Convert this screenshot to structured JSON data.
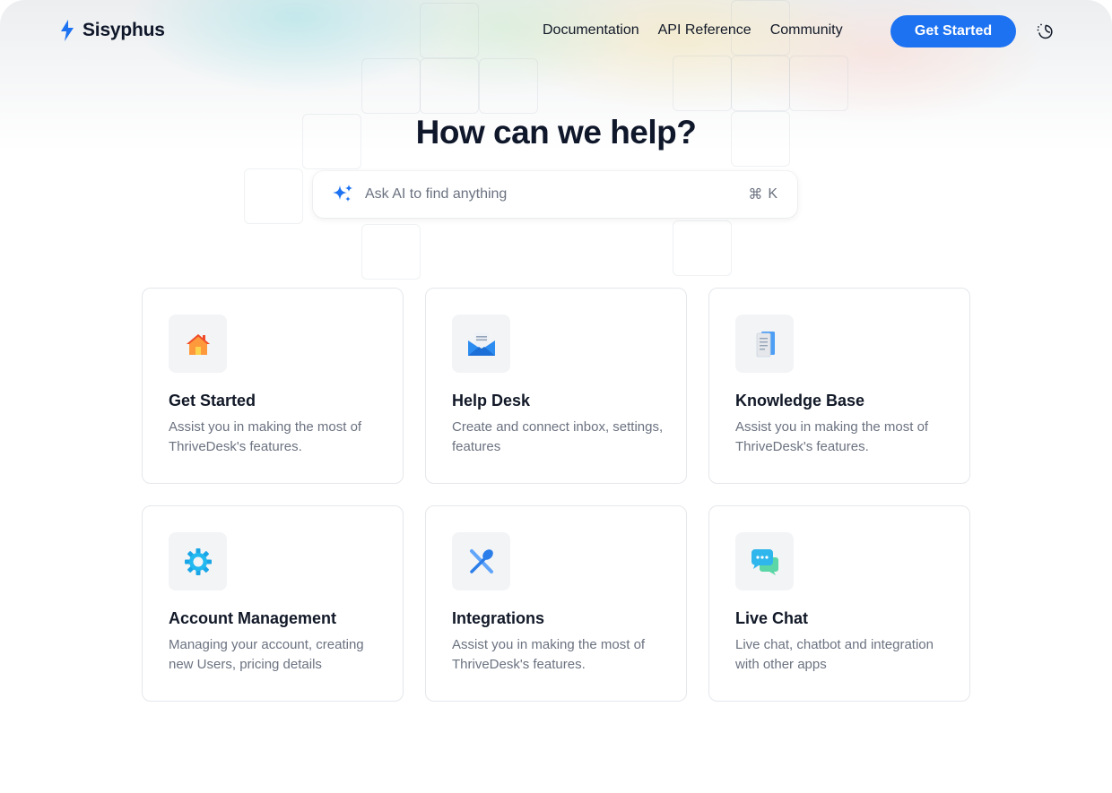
{
  "brand": {
    "name": "Sisyphus",
    "accent": "#1d72f2"
  },
  "nav": {
    "items": [
      {
        "label": "Documentation"
      },
      {
        "label": "API Reference"
      },
      {
        "label": "Community"
      }
    ],
    "cta_label": "Get Started",
    "theme_toggle_icon": "moon-sun-icon"
  },
  "hero": {
    "title": "How can we help?",
    "search": {
      "placeholder": "Ask AI to find anything",
      "shortcut_symbol": "⌘",
      "shortcut_key": "K"
    }
  },
  "cards": [
    {
      "icon": "house-icon",
      "title": "Get Started",
      "description": "Assist you in making the most of ThriveDesk's features."
    },
    {
      "icon": "envelope-icon",
      "title": "Help Desk",
      "description": "Create and connect inbox, settings, features"
    },
    {
      "icon": "document-icon",
      "title": "Knowledge Base",
      "description": "Assist you in making the most of ThriveDesk's features."
    },
    {
      "icon": "gear-icon",
      "title": "Account Management",
      "description": "Managing your account, creating new Users, pricing details"
    },
    {
      "icon": "utensils-icon",
      "title": "Integrations",
      "description": "Assist you in making the most of ThriveDesk's features."
    },
    {
      "icon": "chat-bubble-icon",
      "title": "Live Chat",
      "description": "Live chat, chatbot and integration with other apps"
    }
  ]
}
